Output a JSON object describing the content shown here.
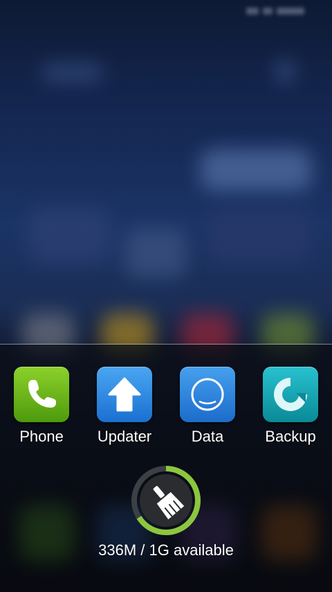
{
  "recent_apps": [
    {
      "label": "Phone",
      "icon": "phone-icon",
      "color": "#5aa718"
    },
    {
      "label": "Updater",
      "icon": "up-arrow-icon",
      "color": "#2a80dc"
    },
    {
      "label": "Data",
      "icon": "ring-icon",
      "color": "#2a7ed8"
    },
    {
      "label": "Backup",
      "icon": "backup-icon",
      "color": "#14a3b0"
    }
  ],
  "memory": {
    "text": "336M / 1G available",
    "used_fraction": 0.66,
    "ring_color": "#8cc63f",
    "icon": "broom-icon"
  }
}
